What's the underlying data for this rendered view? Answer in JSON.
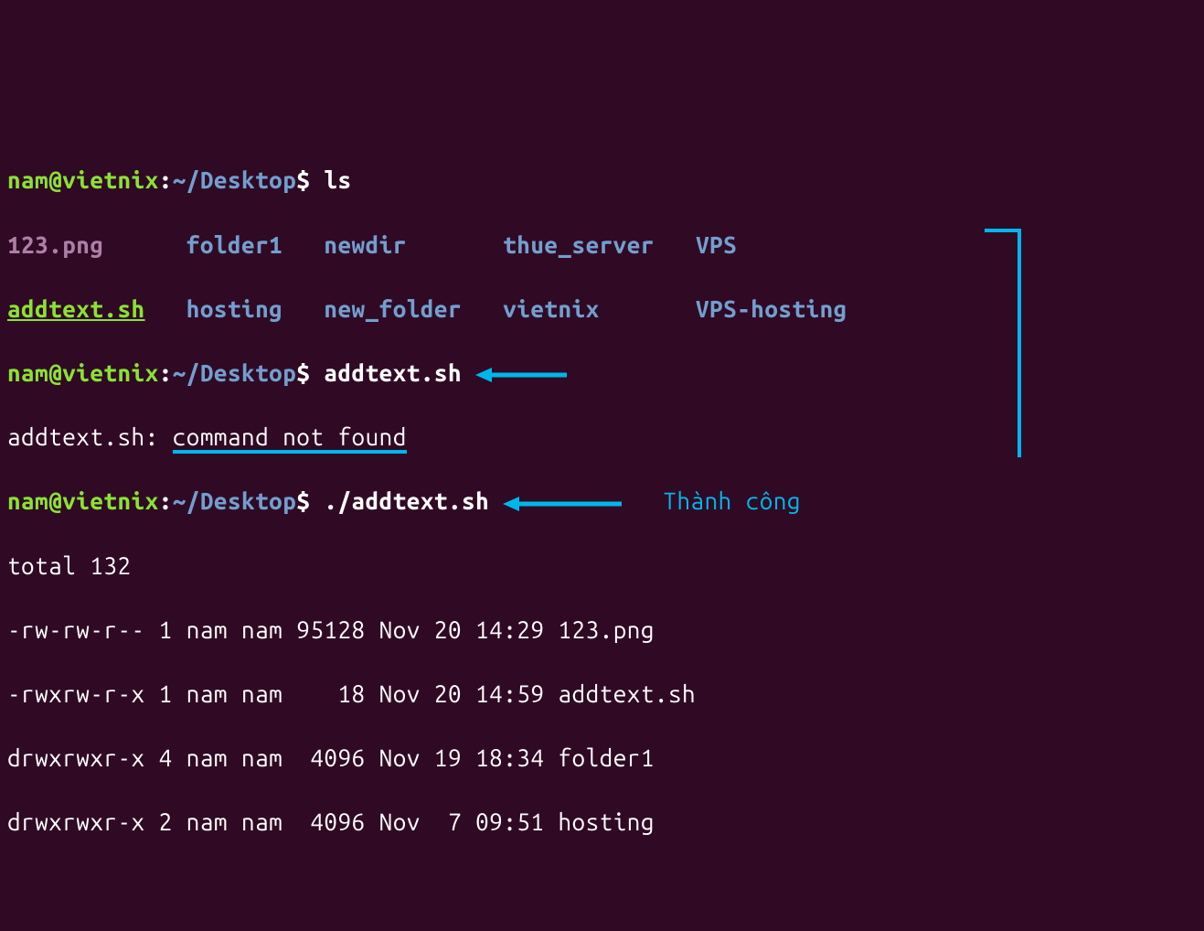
{
  "prompt": {
    "user": "nam",
    "at": "@",
    "host": "vietnix",
    "colon": ":",
    "path": "~/Desktop",
    "dollar": "$"
  },
  "commands": {
    "ls": "ls",
    "attempt1": "addtext.sh",
    "attempt2": "./addtext.sh"
  },
  "ls_output": {
    "row1": {
      "c1": "123.png",
      "c2": "folder1",
      "c3": "newdir",
      "c4": "thue_server",
      "c5": "VPS"
    },
    "row2": {
      "c1": "addtext.sh",
      "c2": "hosting",
      "c3": "new_folder",
      "c4": "vietnix",
      "c5": "VPS-hosting"
    }
  },
  "error": {
    "prefix": "addtext.sh: ",
    "message": "command not found"
  },
  "script_output": {
    "total": "total 132",
    "rows": [
      {
        "perm": "-rw-rw-r--",
        "links": "1",
        "owner": "nam",
        "group": "nam",
        "size": "95128",
        "month": "Nov",
        "day": "20",
        "time": "14:29",
        "name": "123.png"
      },
      {
        "perm": "-rwxrw-r-x",
        "links": "1",
        "owner": "nam",
        "group": "nam",
        "size": "   18",
        "month": "Nov",
        "day": "20",
        "time": "14:59",
        "name": "addtext.sh"
      },
      {
        "perm": "drwxrwxr-x",
        "links": "4",
        "owner": "nam",
        "group": "nam",
        "size": " 4096",
        "month": "Nov",
        "day": "19",
        "time": "18:34",
        "name": "folder1"
      },
      {
        "perm": "drwxrwxr-x",
        "links": "2",
        "owner": "nam",
        "group": "nam",
        "size": " 4096",
        "month": "Nov",
        "day": " 7",
        "time": "09:51",
        "name": "hosting"
      }
    ]
  },
  "annotation": {
    "success_label": "Thành công"
  }
}
